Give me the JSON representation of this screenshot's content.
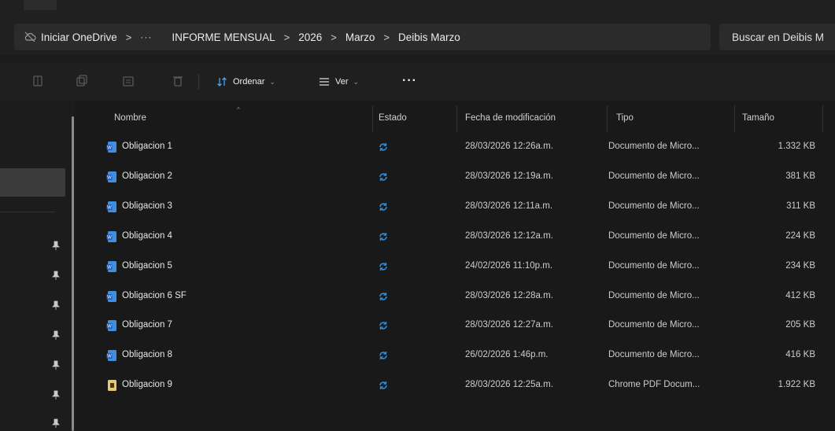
{
  "breadcrumb": {
    "items": [
      "Iniciar OneDrive",
      "···",
      "INFORME MENSUAL",
      "2026",
      "Marzo",
      "Deibis Marzo"
    ],
    "separator": ">"
  },
  "search": {
    "placeholder": "Buscar en Deibis M"
  },
  "toolbar": {
    "sort_label": "Ordenar",
    "view_label": "Ver",
    "more_label": "···"
  },
  "columns": {
    "name": "Nombre",
    "status": "Estado",
    "date": "Fecha de modificación",
    "type": "Tipo",
    "size": "Tamaño"
  },
  "files": [
    {
      "name": "Obligacion 1",
      "date": "28/03/2026 12:26a.m.",
      "type": "Documento de Micro...",
      "size": "1.332 KB",
      "icon": "word-document-icon"
    },
    {
      "name": "Obligacion 2",
      "date": "28/03/2026 12:19a.m.",
      "type": "Documento de Micro...",
      "size": "381 KB",
      "icon": "word-document-icon"
    },
    {
      "name": "Obligacion 3",
      "date": "28/03/2026 12:11a.m.",
      "type": "Documento de Micro...",
      "size": "311 KB",
      "icon": "word-document-icon"
    },
    {
      "name": "Obligacion 4",
      "date": "28/03/2026 12:12a.m.",
      "type": "Documento de Micro...",
      "size": "224 KB",
      "icon": "word-document-icon"
    },
    {
      "name": "Obligacion 5",
      "date": "24/02/2026 11:10p.m.",
      "type": "Documento de Micro...",
      "size": "234 KB",
      "icon": "word-document-icon"
    },
    {
      "name": "Obligacion 6 SF",
      "date": "28/03/2026 12:28a.m.",
      "type": "Documento de Micro...",
      "size": "412 KB",
      "icon": "word-document-icon"
    },
    {
      "name": "Obligacion 7",
      "date": "28/03/2026 12:27a.m.",
      "type": "Documento de Micro...",
      "size": "205 KB",
      "icon": "word-document-icon"
    },
    {
      "name": "Obligacion 8",
      "date": "26/02/2026 1:46p.m.",
      "type": "Documento de Micro...",
      "size": "416 KB",
      "icon": "word-document-icon"
    },
    {
      "name": "Obligacion 9",
      "date": "28/03/2026 12:25a.m.",
      "type": "Chrome PDF Docum...",
      "size": "1.922 KB",
      "icon": "pdf-document-icon"
    }
  ],
  "colors": {
    "sync_status": "#2f8bd8",
    "word_icon": "#3f8fe0",
    "pdf_icon": "#e8c872",
    "highlight": "#3b3b3b"
  }
}
